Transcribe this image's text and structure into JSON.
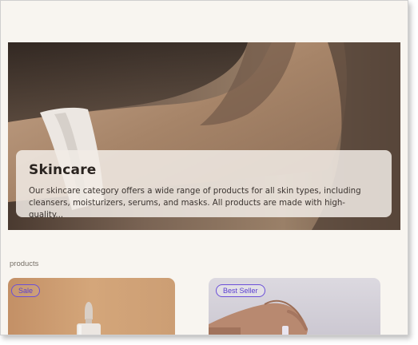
{
  "hero": {
    "title": "Skincare",
    "description_line1": "Our skincare category offers a wide range of products for all skin types, including",
    "description_line2": "cleansers, moisturizers, serums, and masks. All products are made with high-quality..."
  },
  "products_section": {
    "label": "products"
  },
  "product_cards": [
    {
      "badge": "Sale",
      "image": "dropper-bottle"
    },
    {
      "badge": "Best Seller",
      "image": "hand-with-product"
    }
  ],
  "colors": {
    "page_background": "#f8f5f0",
    "badge_accent": "#5a3fd0",
    "hero_card_background": "#f1ebe5"
  }
}
